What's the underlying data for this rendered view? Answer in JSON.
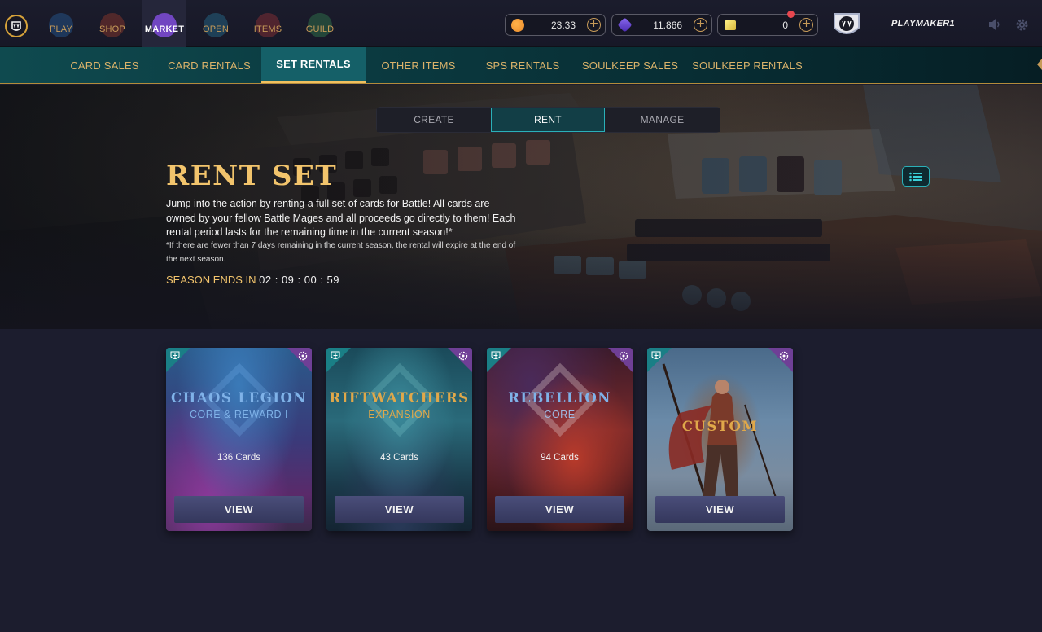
{
  "topbar": {
    "nav": [
      {
        "label": "PLAY",
        "icon": "play-icon",
        "color": "#2a6fb8"
      },
      {
        "label": "SHOP",
        "icon": "shop-icon",
        "color": "#b8432a"
      },
      {
        "label": "MARKET",
        "icon": "market-icon",
        "color": "#7a4ad0",
        "active": true
      },
      {
        "label": "OPEN",
        "icon": "open-icon",
        "color": "#2a8ab0"
      },
      {
        "label": "ITEMS",
        "icon": "items-icon",
        "color": "#b83a3a"
      },
      {
        "label": "GUILD",
        "icon": "guild-icon",
        "color": "#3a9a5a"
      }
    ],
    "currencies": [
      {
        "icon": "dec-coin-icon",
        "value": "23.33",
        "color": "#e8892a"
      },
      {
        "icon": "sps-gem-icon",
        "value": "11.866",
        "color": "#6a4ad8"
      },
      {
        "icon": "voucher-icon",
        "value": "0",
        "color": "#e8d84a"
      }
    ],
    "username": "PLAYMAKER1"
  },
  "subnav": {
    "tabs": [
      {
        "label": "CARD SALES"
      },
      {
        "label": "CARD RENTALS"
      },
      {
        "label": "SET RENTALS",
        "active": true
      },
      {
        "label": "OTHER ITEMS"
      },
      {
        "label": "SPS RENTALS"
      },
      {
        "label": "SOULKEEP SALES"
      },
      {
        "label": "SOULKEEP RENTALS"
      }
    ]
  },
  "hero": {
    "segments": [
      {
        "label": "CREATE"
      },
      {
        "label": "RENT",
        "active": true
      },
      {
        "label": "MANAGE"
      }
    ],
    "title": "RENT SET",
    "description": "Jump into the action by renting a full set of cards for Battle! All cards are owned by your fellow Battle Mages and all proceeds go directly to them! Each rental period lasts for the remaining time in the current season!*",
    "note": "*If there are fewer than 7 days remaining in the current season, the rental will expire at the end of the next season.",
    "season_label": "SEASON ENDS IN",
    "season_time": "02 : 09 : 00 : 59"
  },
  "cards": [
    {
      "title": "CHAOS LEGION",
      "subtitle": "- CORE & REWARD I -",
      "count": "136 Cards",
      "view": "VIEW",
      "title_color": "#7fb2e8",
      "sub_color": "#7fb2e8"
    },
    {
      "title": "RIFTWATCHERS",
      "subtitle": "- EXPANSION -",
      "count": "43 Cards",
      "view": "VIEW",
      "title_color": "#e0a84a",
      "sub_color": "#e0a84a"
    },
    {
      "title": "REBELLION",
      "subtitle": "- CORE -",
      "count": "94 Cards",
      "view": "VIEW",
      "title_color": "#7fb2e8",
      "sub_color": "#9fb8e0"
    },
    {
      "title": "CUSTOM",
      "subtitle": "",
      "count": "",
      "view": "VIEW",
      "title_color": "#e0a84a",
      "sub_color": "#e0a84a"
    }
  ]
}
